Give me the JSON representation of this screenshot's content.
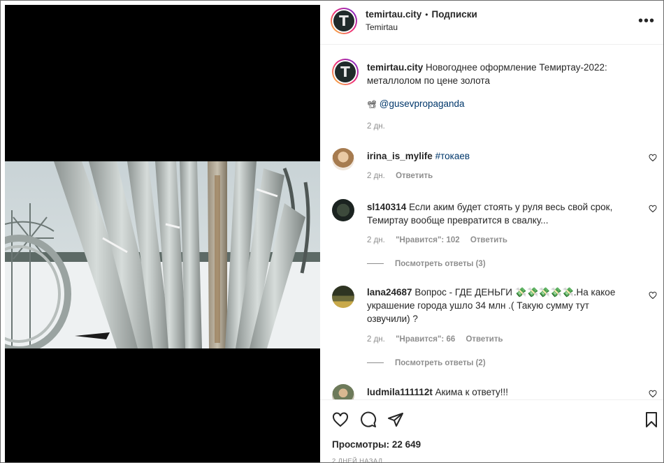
{
  "header": {
    "username": "temirtau.city",
    "separator": "•",
    "follow_label": "Подписки",
    "location": "Temirtau",
    "more_label": "•••"
  },
  "caption": {
    "username": "temirtau.city",
    "text": "Новогоднее оформление Темиртау-2022: металлолом по цене золота",
    "mention_prefix": "📽",
    "mention": "@gusevpropaganda",
    "time": "2 дн."
  },
  "comments": [
    {
      "username": "irina_is_mylife",
      "text": "",
      "hashtag": "#токаев",
      "time": "2 дн.",
      "likes": "",
      "reply_label": "Ответить"
    },
    {
      "username": "sl140314",
      "text": "Если аким будет стоять у руля весь свой срок, Темиртау вообще превратится в свалку...",
      "hashtag": "",
      "time": "2 дн.",
      "likes": "\"Нравится\": 102",
      "reply_label": "Ответить",
      "view_replies": "Посмотреть ответы (3)"
    },
    {
      "username": "lana24687",
      "text": "Вопрос - ГДЕ ДЕНЬГИ 💸💸💸💸💸.На какое украшение города ушло 34 млн .( Такую сумму тут озвучили) ?",
      "hashtag": "",
      "time": "2 дн.",
      "likes": "\"Нравится\": 66",
      "reply_label": "Ответить",
      "view_replies": "Посмотреть ответы (2)"
    },
    {
      "username": "ludmila111112t",
      "text": "Акима к ответу!!!",
      "hashtag": "",
      "time": "",
      "likes": "",
      "reply_label": ""
    }
  ],
  "footer": {
    "views": "Просмотры: 22 649",
    "posted": "2 ДНЕЙ НАЗАД"
  },
  "colors": {
    "link": "#00376b",
    "text": "#262626",
    "muted": "#8e8e8e"
  }
}
